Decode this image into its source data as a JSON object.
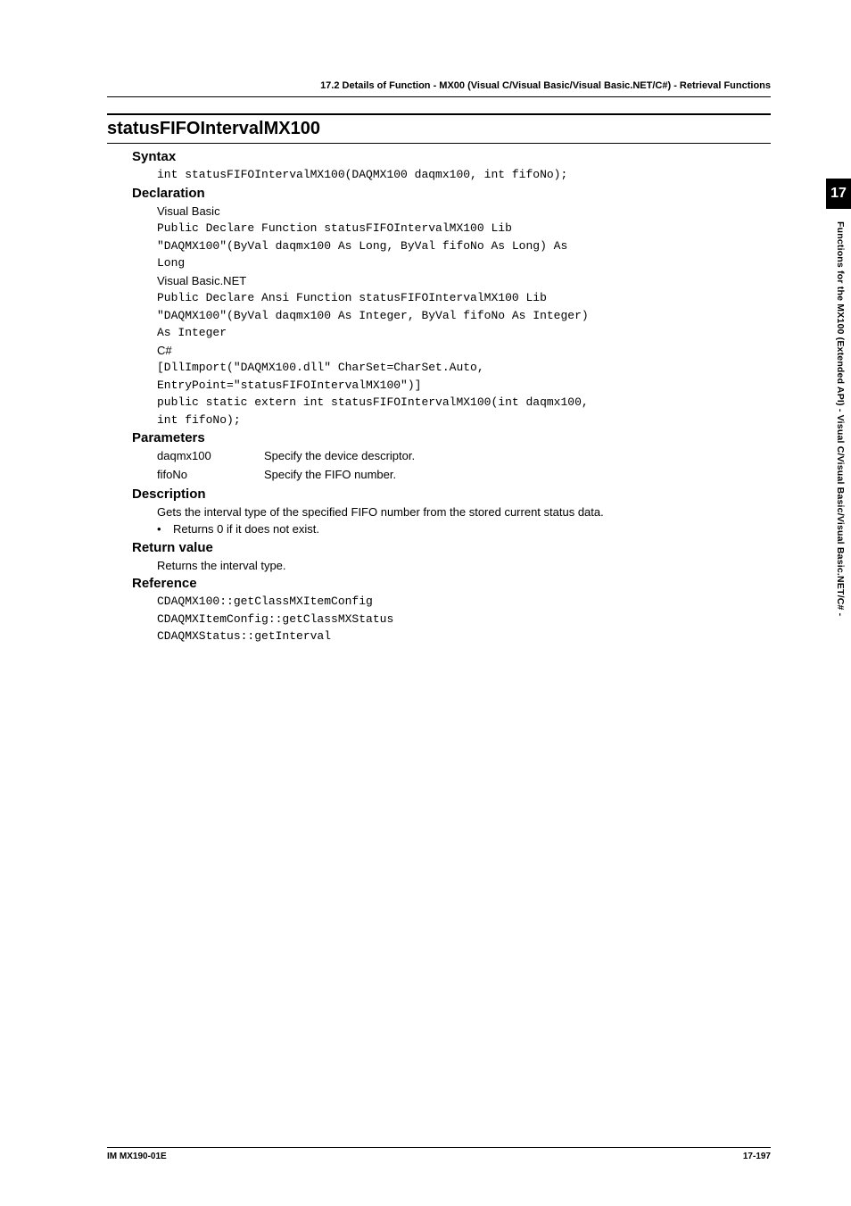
{
  "header": "17.2  Details of  Function - MX00 (Visual C/Visual Basic/Visual Basic.NET/C#) - Retrieval Functions",
  "sectionTitle": "statusFIFOIntervalMX100",
  "syntax": {
    "heading": "Syntax",
    "code": "int statusFIFOIntervalMX100(DAQMX100 daqmx100, int fifoNo);"
  },
  "declaration": {
    "heading": "Declaration",
    "vbLabel": "Visual Basic",
    "vbCode": "Public Declare Function statusFIFOIntervalMX100 Lib\n\"DAQMX100\"(ByVal daqmx100 As Long, ByVal fifoNo As Long) As\nLong",
    "vbnetLabel": "Visual Basic.NET",
    "vbnetCode": "Public Declare Ansi Function statusFIFOIntervalMX100 Lib\n\"DAQMX100\"(ByVal daqmx100 As Integer, ByVal fifoNo As Integer)\nAs Integer",
    "csharpLabel": "C#",
    "csharpCode": "[DllImport(\"DAQMX100.dll\" CharSet=CharSet.Auto,\nEntryPoint=\"statusFIFOIntervalMX100\")]\npublic static extern int statusFIFOIntervalMX100(int daqmx100,\nint fifoNo);"
  },
  "parameters": {
    "heading": "Parameters",
    "items": [
      {
        "name": "daqmx100",
        "desc": "Specify the device descriptor."
      },
      {
        "name": "fifoNo",
        "desc": "Specify the FIFO number."
      }
    ]
  },
  "description": {
    "heading": "Description",
    "text": "Gets the interval type of the specified FIFO number from the stored current status data.",
    "bullets": [
      "Returns 0 if it does not exist."
    ]
  },
  "returnValue": {
    "heading": "Return value",
    "text": "Returns the interval type."
  },
  "reference": {
    "heading": "Reference",
    "code": "CDAQMX100::getClassMXItemConfig\nCDAQMXItemConfig::getClassMXStatus\nCDAQMXStatus::getInterval"
  },
  "sideTab": "17",
  "sideText": "Functions for the MX100 (Extended API) - Visual C/Visual Basic/Visual Basic.NET/C# -",
  "footer": {
    "left": "IM MX190-01E",
    "right": "17-197"
  }
}
